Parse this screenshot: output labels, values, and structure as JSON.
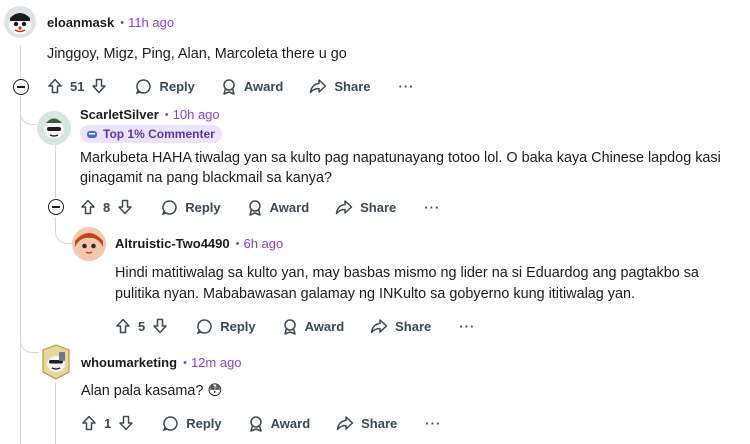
{
  "comments": [
    {
      "username": "eloanmask",
      "time": "11h ago",
      "body": "Jinggoy, Migz, Ping, Alan, Marcoleta there u go",
      "votes": "51"
    },
    {
      "username": "ScarletSilver",
      "time": "10h ago",
      "badge": "Top 1% Commenter",
      "body_lines": [
        "Markubeta HAHA tiwalag yan sa kulto pag napatunayang totoo lol. O baka kaya Chinese lapdog kasi",
        "ginagamit na pang blackmail sa kanya?"
      ],
      "votes": "8"
    },
    {
      "username": "Altruistic-Two4490",
      "time": "6h ago",
      "body_lines": [
        "Hindi matitiwalag sa kulto yan, may basbas mismo ng lider na si Eduardog ang pagtakbo sa",
        "pulitika nyan. Mababawasan galamay ng INKulto sa gobyerno kung ititiwalag yan."
      ],
      "votes": "5"
    },
    {
      "username": "whoumarketing",
      "time": "12m ago",
      "body": "Alan pala kasama? 😳",
      "votes": "1"
    }
  ],
  "actions": {
    "reply": "Reply",
    "award": "Award",
    "share": "Share",
    "more": "···"
  },
  "colors": {
    "time": "#8b3fd9",
    "badge_bg": "#ece2fb",
    "thread_line": "#d4d7d9"
  }
}
